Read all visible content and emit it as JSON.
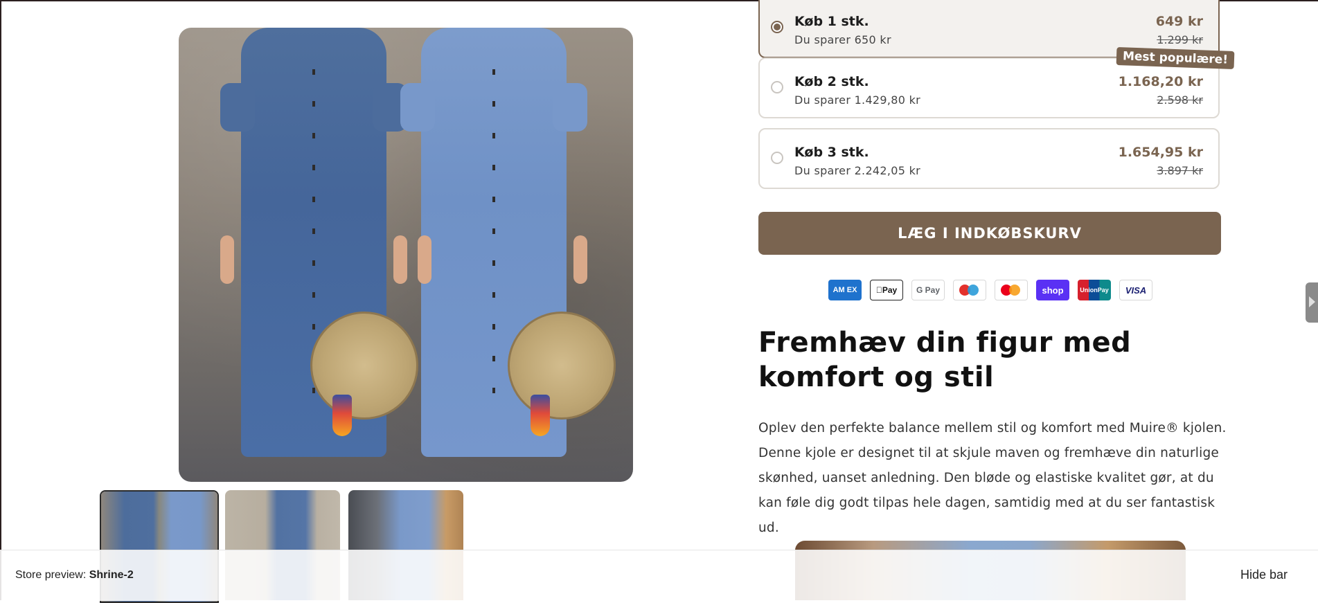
{
  "options": [
    {
      "title": "Køb 1 stk.",
      "savings": "Du sparer 650 kr",
      "price": "649 kr",
      "old_price": "1.299 kr"
    },
    {
      "title": "Køb 2 stk.",
      "savings": "Du sparer 1.429,80 kr",
      "price": "1.168,20 kr",
      "old_price": "2.598 kr"
    },
    {
      "title": "Køb 3 stk.",
      "savings": "Du sparer 2.242,05 kr",
      "price": "1.654,95 kr",
      "old_price": "3.897 kr"
    }
  ],
  "selected_option": 0,
  "popular_badge": "Mest populære!",
  "cart_button": "LÆG I INDKØBSKURV",
  "payment_methods": [
    {
      "icon": "amex-icon",
      "label": "AM EX"
    },
    {
      "icon": "apple-pay-icon",
      "label": "Pay"
    },
    {
      "icon": "google-pay-icon",
      "label": "G Pay"
    },
    {
      "icon": "maestro-icon",
      "label": ""
    },
    {
      "icon": "mastercard-icon",
      "label": ""
    },
    {
      "icon": "shop-pay-icon",
      "label": "shop"
    },
    {
      "icon": "unionpay-icon",
      "label": "UnionPay"
    },
    {
      "icon": "visa-icon",
      "label": "VISA"
    }
  ],
  "heading": "Fremhæv din figur med komfort og stil",
  "description": "Oplev den perfekte balance mellem stil og komfort med Muire® kjolen. Denne kjole er designet til at skjule maven og fremhæve din naturlige skønhed, uanset anledning. Den bløde og elastiske kvalitet gør, at du kan føle dig godt tilpas hele dagen, samtidig med at du ser fantastisk ud.",
  "preview_bar": {
    "label": "Store preview:",
    "store_name": "Shrine-2",
    "hide_label": "Hide bar"
  },
  "colors": {
    "accent": "#7a6450",
    "amex": "#1f72cd",
    "shop_pay": "#5a31f4"
  }
}
